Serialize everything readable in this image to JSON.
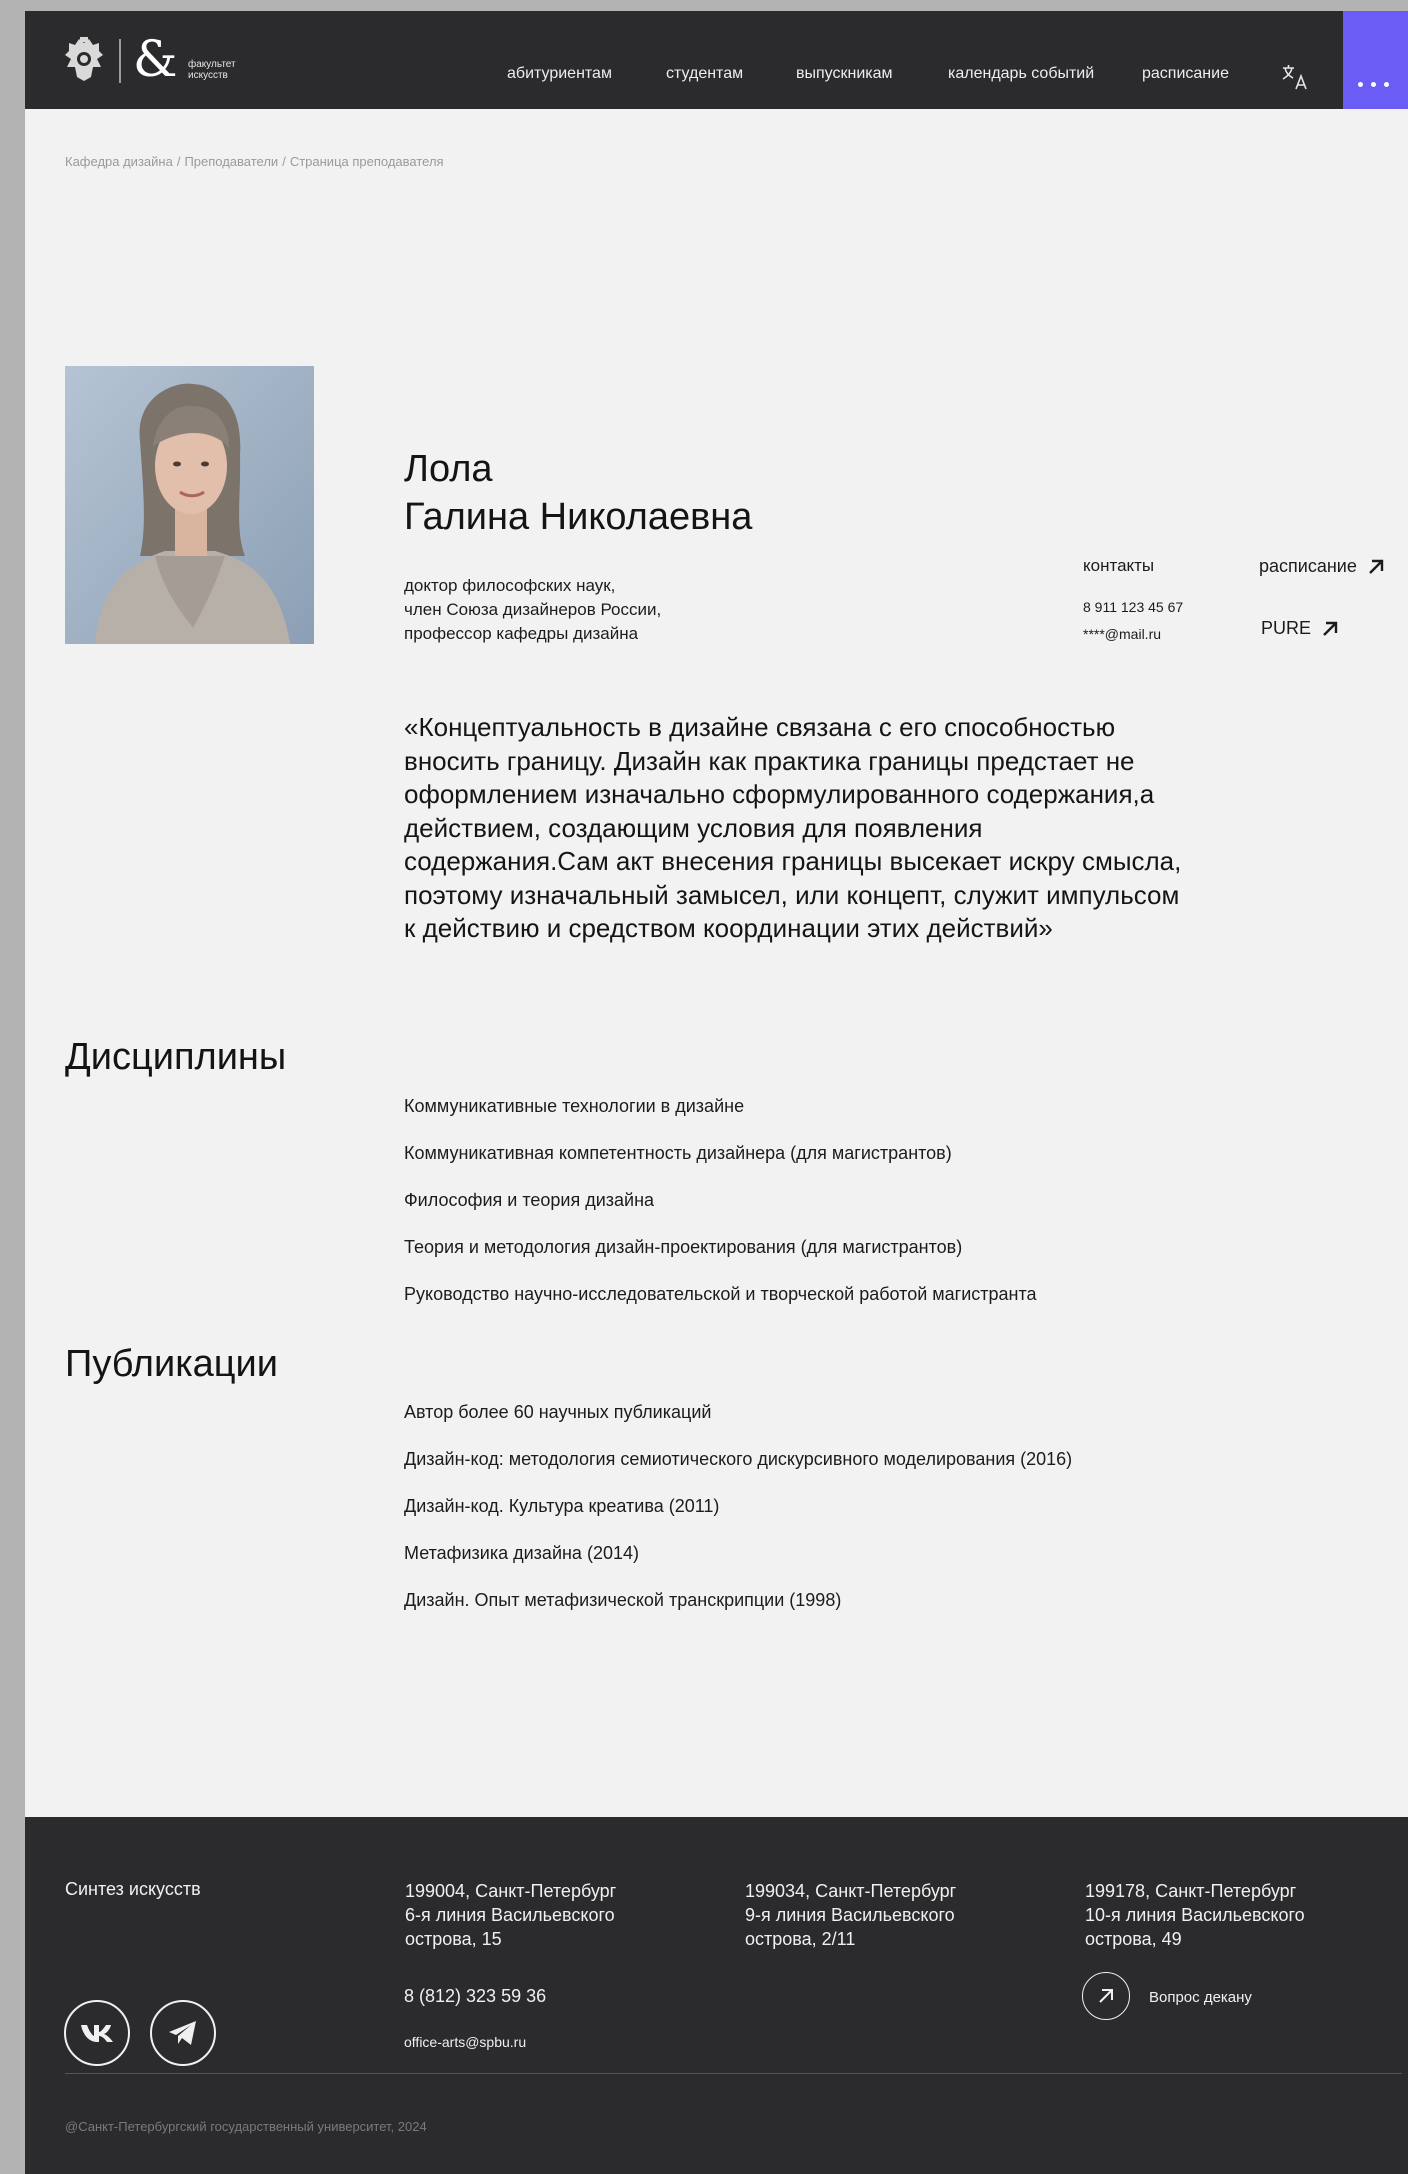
{
  "header": {
    "logo_text_line1": "факультет",
    "logo_text_line2": "искусств",
    "logo_amp": "&",
    "nav": [
      {
        "label": "абитуриентам"
      },
      {
        "label": "студентам"
      },
      {
        "label": "выпускникам"
      },
      {
        "label": "календарь событий"
      },
      {
        "label": "расписание"
      }
    ],
    "translate_icon": "translate-icon",
    "menu_icon": "more-dots-icon",
    "accent_color": "#6b5cf6"
  },
  "breadcrumb": {
    "items": [
      "Кафедра дизайна",
      "Преподаватели",
      "Страница преподавателя"
    ],
    "separator": "/"
  },
  "profile": {
    "surname": "Лола",
    "given_names": "Галина Николаевна",
    "credentials": [
      "доктор философских наук,",
      "член Союза дизайнеров России,",
      "профессор кафедры дизайна"
    ],
    "contacts_label": "контакты",
    "phone": "8 911 123 45 67",
    "email": "****@mail.ru",
    "schedule_link": "расписание",
    "pure_link": "PURE",
    "quote": "«Концептуальность в дизайне связана с его способностью вносить границу. Дизайн как практика границы предстает не оформлением изначально сформулированного содержания,а действием, создающим условия для появления содержания.Сам акт внесения границы высекает искру смысла, поэтому изначальный замысел, или концепт, служит импульсом к действию и средством координации этих действий»"
  },
  "disciplines": {
    "title": "Дисциплины",
    "items": [
      "Коммуникативные технологии в дизайне",
      "Коммуникативная компетентность дизайнера (для магистрантов)",
      "Философия и теория дизайна",
      "Теория и методология дизайн-проектирования (для магистрантов)",
      "Руководство научно-исследовательской и творческой работой магистранта"
    ]
  },
  "publications": {
    "title": "Публикации",
    "items": [
      "Автор более 60 научных публикаций",
      "Дизайн-код: методология семиотического дискурсивного моделирования (2016)",
      "Дизайн-код. Культура креатива (2011)",
      "Метафизика дизайна (2014)",
      "Дизайн. Опыт метафизической транскрипции (1998)"
    ]
  },
  "footer": {
    "brand": "Синтез искусств",
    "addresses": [
      [
        "199004, Санкт-Петербург",
        "6-я линия Васильевского",
        "острова, 15"
      ],
      [
        "199034, Санкт-Петербург",
        "9-я линия Васильевского",
        "острова, 2/11"
      ],
      [
        "199178, Санкт-Петербург",
        "10-я линия Васильевского",
        "острова, 49"
      ]
    ],
    "phone": "8 (812) 323 59 36",
    "email": "office-arts@spbu.ru",
    "dean_question": "Вопрос декану",
    "social": [
      "vk-icon",
      "telegram-icon"
    ],
    "copyright": "@Санкт-Петербургский государственный университет, 2024"
  }
}
